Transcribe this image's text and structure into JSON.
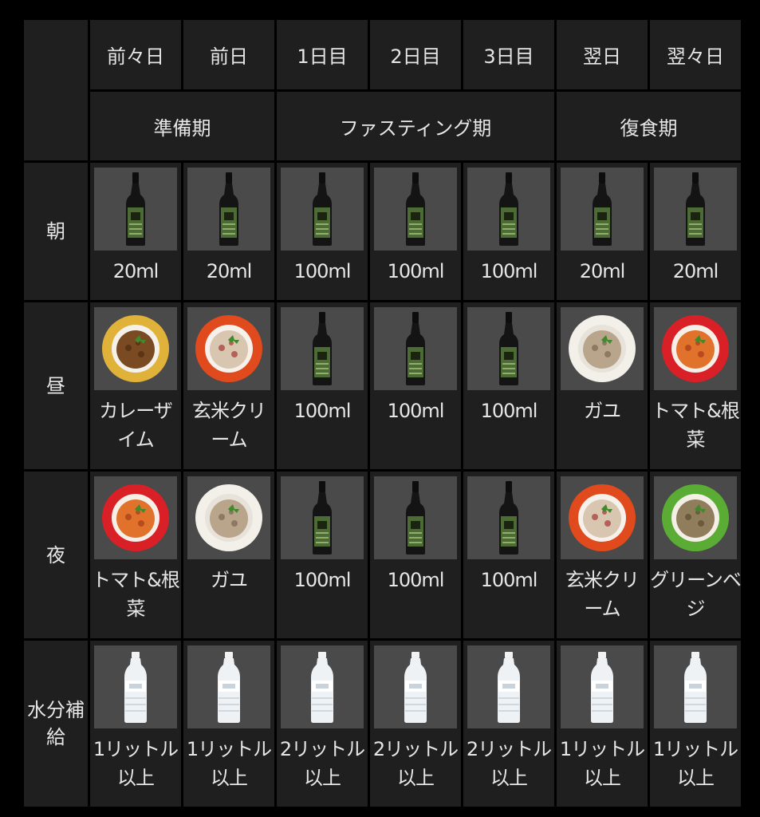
{
  "days": [
    "前々日",
    "前日",
    "1日目",
    "2日目",
    "3日目",
    "翌日",
    "翌々日"
  ],
  "phases": [
    {
      "label": "準備期",
      "span": 2
    },
    {
      "label": "ファスティング期",
      "span": 3
    },
    {
      "label": "復食期",
      "span": 2
    }
  ],
  "rows": [
    {
      "label": "朝",
      "cells": [
        {
          "icon": "supplement-bottle-icon",
          "label": "20ml"
        },
        {
          "icon": "supplement-bottle-icon",
          "label": "20ml"
        },
        {
          "icon": "supplement-bottle-icon",
          "label": "100ml"
        },
        {
          "icon": "supplement-bottle-icon",
          "label": "100ml"
        },
        {
          "icon": "supplement-bottle-icon",
          "label": "100ml"
        },
        {
          "icon": "supplement-bottle-icon",
          "label": "20ml"
        },
        {
          "icon": "supplement-bottle-icon",
          "label": "20ml"
        }
      ]
    },
    {
      "label": "昼",
      "cells": [
        {
          "icon": "curry-risotto-bowl-icon",
          "label": "カレーザイム"
        },
        {
          "icon": "brown-rice-cream-bowl-icon",
          "label": "玄米クリーム"
        },
        {
          "icon": "supplement-bottle-icon",
          "label": "100ml"
        },
        {
          "icon": "supplement-bottle-icon",
          "label": "100ml"
        },
        {
          "icon": "supplement-bottle-icon",
          "label": "100ml"
        },
        {
          "icon": "gayu-bowl-icon",
          "label": "ガユ"
        },
        {
          "icon": "tomato-root-veg-bowl-icon",
          "label": "トマト&根菜"
        }
      ]
    },
    {
      "label": "夜",
      "cells": [
        {
          "icon": "tomato-root-veg-bowl-icon",
          "label": "トマト&根菜"
        },
        {
          "icon": "gayu-bowl-icon",
          "label": "ガユ"
        },
        {
          "icon": "supplement-bottle-icon",
          "label": "100ml"
        },
        {
          "icon": "supplement-bottle-icon",
          "label": "100ml"
        },
        {
          "icon": "supplement-bottle-icon",
          "label": "100ml"
        },
        {
          "icon": "brown-rice-cream-bowl-icon",
          "label": "玄米クリーム"
        },
        {
          "icon": "green-veggie-bowl-icon",
          "label": "グリーンベジ"
        }
      ]
    },
    {
      "label": "水分補給",
      "cells": [
        {
          "icon": "water-bottle-icon",
          "label": "1リットル以上"
        },
        {
          "icon": "water-bottle-icon",
          "label": "1リットル以上"
        },
        {
          "icon": "water-bottle-icon",
          "label": "2リットル以上"
        },
        {
          "icon": "water-bottle-icon",
          "label": "2リットル以上"
        },
        {
          "icon": "water-bottle-icon",
          "label": "2リットル以上"
        },
        {
          "icon": "water-bottle-icon",
          "label": "1リットル以上"
        },
        {
          "icon": "water-bottle-icon",
          "label": "1リットル以上"
        }
      ]
    }
  ],
  "colors": {
    "background": "#000000",
    "cell": "#1f1f1f",
    "thumb": "#4a4a4a",
    "text": "#e6e6e6"
  }
}
